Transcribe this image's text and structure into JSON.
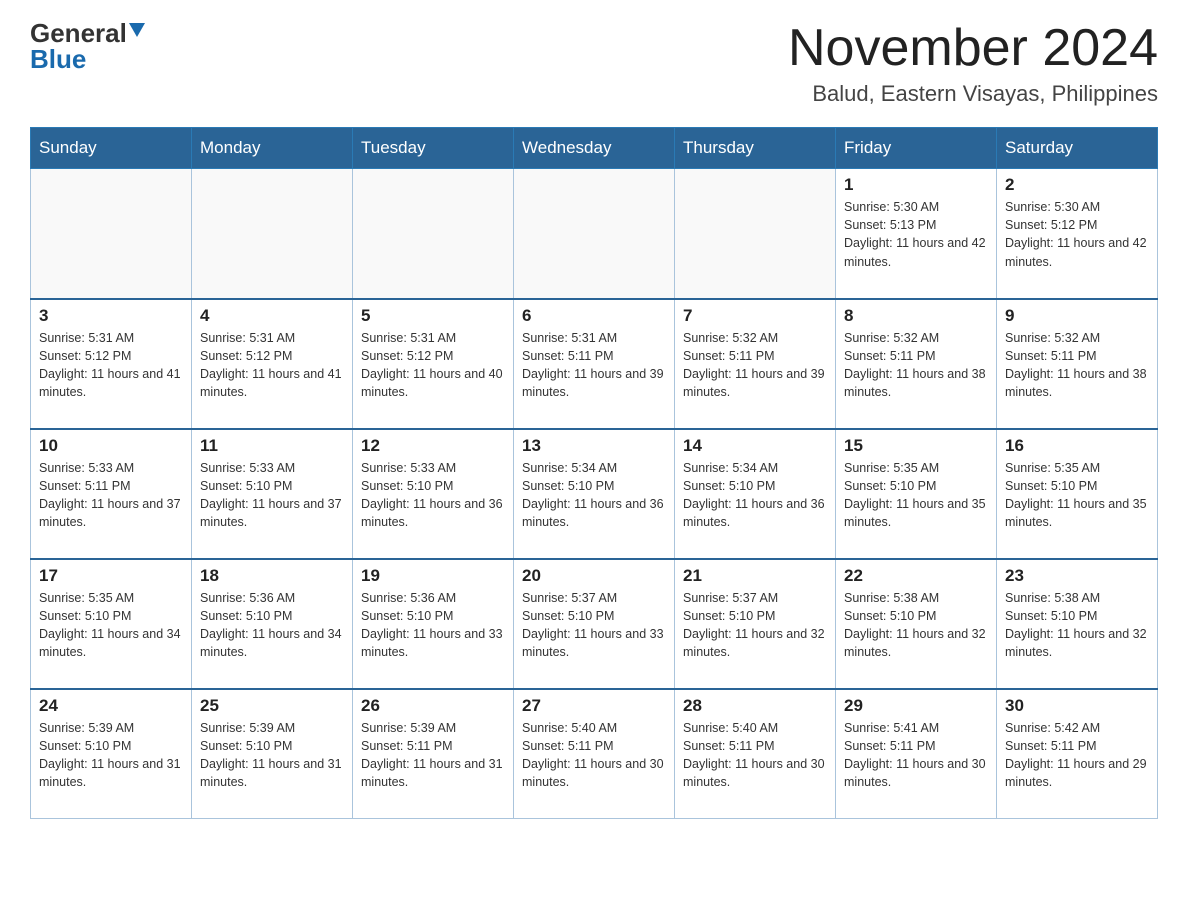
{
  "header": {
    "logo_general": "General",
    "logo_blue": "Blue",
    "month_title": "November 2024",
    "location": "Balud, Eastern Visayas, Philippines"
  },
  "weekdays": [
    "Sunday",
    "Monday",
    "Tuesday",
    "Wednesday",
    "Thursday",
    "Friday",
    "Saturday"
  ],
  "weeks": [
    [
      {
        "day": "",
        "info": ""
      },
      {
        "day": "",
        "info": ""
      },
      {
        "day": "",
        "info": ""
      },
      {
        "day": "",
        "info": ""
      },
      {
        "day": "",
        "info": ""
      },
      {
        "day": "1",
        "info": "Sunrise: 5:30 AM\nSunset: 5:13 PM\nDaylight: 11 hours and 42 minutes."
      },
      {
        "day": "2",
        "info": "Sunrise: 5:30 AM\nSunset: 5:12 PM\nDaylight: 11 hours and 42 minutes."
      }
    ],
    [
      {
        "day": "3",
        "info": "Sunrise: 5:31 AM\nSunset: 5:12 PM\nDaylight: 11 hours and 41 minutes."
      },
      {
        "day": "4",
        "info": "Sunrise: 5:31 AM\nSunset: 5:12 PM\nDaylight: 11 hours and 41 minutes."
      },
      {
        "day": "5",
        "info": "Sunrise: 5:31 AM\nSunset: 5:12 PM\nDaylight: 11 hours and 40 minutes."
      },
      {
        "day": "6",
        "info": "Sunrise: 5:31 AM\nSunset: 5:11 PM\nDaylight: 11 hours and 39 minutes."
      },
      {
        "day": "7",
        "info": "Sunrise: 5:32 AM\nSunset: 5:11 PM\nDaylight: 11 hours and 39 minutes."
      },
      {
        "day": "8",
        "info": "Sunrise: 5:32 AM\nSunset: 5:11 PM\nDaylight: 11 hours and 38 minutes."
      },
      {
        "day": "9",
        "info": "Sunrise: 5:32 AM\nSunset: 5:11 PM\nDaylight: 11 hours and 38 minutes."
      }
    ],
    [
      {
        "day": "10",
        "info": "Sunrise: 5:33 AM\nSunset: 5:11 PM\nDaylight: 11 hours and 37 minutes."
      },
      {
        "day": "11",
        "info": "Sunrise: 5:33 AM\nSunset: 5:10 PM\nDaylight: 11 hours and 37 minutes."
      },
      {
        "day": "12",
        "info": "Sunrise: 5:33 AM\nSunset: 5:10 PM\nDaylight: 11 hours and 36 minutes."
      },
      {
        "day": "13",
        "info": "Sunrise: 5:34 AM\nSunset: 5:10 PM\nDaylight: 11 hours and 36 minutes."
      },
      {
        "day": "14",
        "info": "Sunrise: 5:34 AM\nSunset: 5:10 PM\nDaylight: 11 hours and 36 minutes."
      },
      {
        "day": "15",
        "info": "Sunrise: 5:35 AM\nSunset: 5:10 PM\nDaylight: 11 hours and 35 minutes."
      },
      {
        "day": "16",
        "info": "Sunrise: 5:35 AM\nSunset: 5:10 PM\nDaylight: 11 hours and 35 minutes."
      }
    ],
    [
      {
        "day": "17",
        "info": "Sunrise: 5:35 AM\nSunset: 5:10 PM\nDaylight: 11 hours and 34 minutes."
      },
      {
        "day": "18",
        "info": "Sunrise: 5:36 AM\nSunset: 5:10 PM\nDaylight: 11 hours and 34 minutes."
      },
      {
        "day": "19",
        "info": "Sunrise: 5:36 AM\nSunset: 5:10 PM\nDaylight: 11 hours and 33 minutes."
      },
      {
        "day": "20",
        "info": "Sunrise: 5:37 AM\nSunset: 5:10 PM\nDaylight: 11 hours and 33 minutes."
      },
      {
        "day": "21",
        "info": "Sunrise: 5:37 AM\nSunset: 5:10 PM\nDaylight: 11 hours and 32 minutes."
      },
      {
        "day": "22",
        "info": "Sunrise: 5:38 AM\nSunset: 5:10 PM\nDaylight: 11 hours and 32 minutes."
      },
      {
        "day": "23",
        "info": "Sunrise: 5:38 AM\nSunset: 5:10 PM\nDaylight: 11 hours and 32 minutes."
      }
    ],
    [
      {
        "day": "24",
        "info": "Sunrise: 5:39 AM\nSunset: 5:10 PM\nDaylight: 11 hours and 31 minutes."
      },
      {
        "day": "25",
        "info": "Sunrise: 5:39 AM\nSunset: 5:10 PM\nDaylight: 11 hours and 31 minutes."
      },
      {
        "day": "26",
        "info": "Sunrise: 5:39 AM\nSunset: 5:11 PM\nDaylight: 11 hours and 31 minutes."
      },
      {
        "day": "27",
        "info": "Sunrise: 5:40 AM\nSunset: 5:11 PM\nDaylight: 11 hours and 30 minutes."
      },
      {
        "day": "28",
        "info": "Sunrise: 5:40 AM\nSunset: 5:11 PM\nDaylight: 11 hours and 30 minutes."
      },
      {
        "day": "29",
        "info": "Sunrise: 5:41 AM\nSunset: 5:11 PM\nDaylight: 11 hours and 30 minutes."
      },
      {
        "day": "30",
        "info": "Sunrise: 5:42 AM\nSunset: 5:11 PM\nDaylight: 11 hours and 29 minutes."
      }
    ]
  ]
}
